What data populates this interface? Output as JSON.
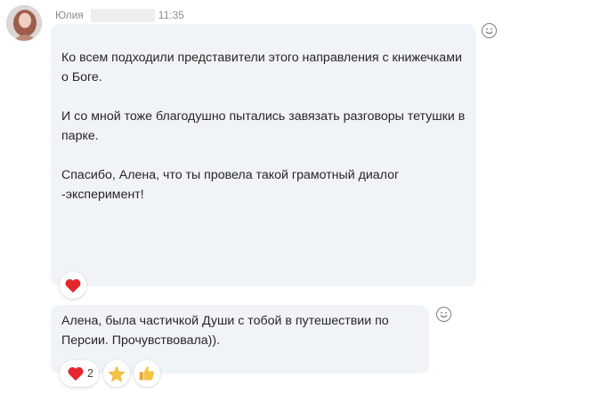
{
  "message_group": {
    "sender_name": "Юлия",
    "time": "11:35",
    "avatar_icon": "user-avatar-photo"
  },
  "messages": [
    {
      "paragraphs": [
        "Ко всем подходили представители этого направления с книжечками о Боге.",
        "И со мной тоже благодушно пытались завязать разговоры тетушки в парке.",
        "Спасибо, Алена, что ты провела такой грамотный диалог -эксперимент!"
      ],
      "reactions": [
        {
          "icon": "heart-icon",
          "count": ""
        }
      ]
    },
    {
      "text": "Алена, была частичкой Души с тобой в путешествии по Персии. Прочувствовала)).",
      "reactions": [
        {
          "icon": "heart-icon",
          "count": "2"
        },
        {
          "icon": "star-icon",
          "count": ""
        },
        {
          "icon": "thumbs-up-icon",
          "count": ""
        }
      ]
    }
  ],
  "colors": {
    "bubble_bg": "#f1f4f7",
    "heart": "#e5262d",
    "star": "#f6c343",
    "thumb": "#f6c343",
    "meta_text": "#8b8b8b"
  }
}
